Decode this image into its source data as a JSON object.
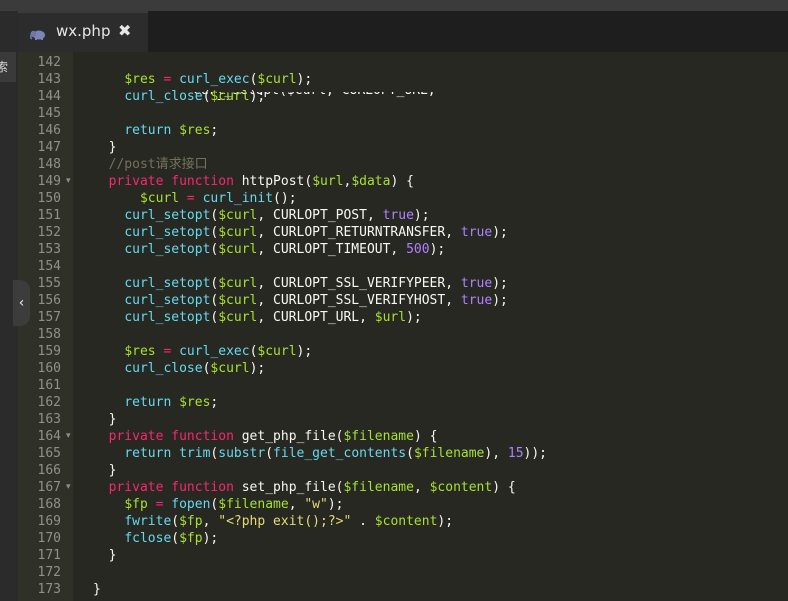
{
  "left_panel": {
    "tab_text": "索"
  },
  "tab": {
    "label": "wx.php",
    "close_glyph": "✖"
  },
  "colors": {
    "variable": "#a6e22e",
    "function": "#66d9ef",
    "keyword": "#f92672",
    "boolean": "#ae81ff",
    "string": "#e6db74",
    "comment": "#75715e",
    "text": "#f8f8f2"
  },
  "lines": [
    {
      "n": "142",
      "fold": "",
      "tokens": []
    },
    {
      "n": "143",
      "fold": "",
      "tokens": [
        [
          "txt",
          "    "
        ],
        [
          "var",
          "$res"
        ],
        [
          "op",
          " = "
        ],
        [
          "fn",
          "curl_exec"
        ],
        [
          "txt",
          "("
        ],
        [
          "var",
          "$curl"
        ],
        [
          "txt",
          ");"
        ]
      ]
    },
    {
      "n": "144",
      "fold": "",
      "tokens": [
        [
          "txt",
          "    "
        ],
        [
          "fn",
          "curl_close"
        ],
        [
          "txt",
          "("
        ],
        [
          "var",
          "$curl"
        ],
        [
          "txt",
          ");"
        ]
      ]
    },
    {
      "n": "145",
      "fold": "",
      "tokens": []
    },
    {
      "n": "146",
      "fold": "",
      "tokens": [
        [
          "txt",
          "    "
        ],
        [
          "fn",
          "return"
        ],
        [
          "txt",
          " "
        ],
        [
          "var",
          "$res"
        ],
        [
          "txt",
          ";"
        ]
      ]
    },
    {
      "n": "147",
      "fold": "",
      "tokens": [
        [
          "txt",
          "  }"
        ]
      ]
    },
    {
      "n": "148",
      "fold": "",
      "tokens": [
        [
          "txt",
          "  "
        ],
        [
          "cmt",
          "//post请求接口"
        ]
      ]
    },
    {
      "n": "149",
      "fold": "▾",
      "tokens": [
        [
          "txt",
          "  "
        ],
        [
          "kw",
          "private"
        ],
        [
          "txt",
          " "
        ],
        [
          "kw",
          "function"
        ],
        [
          "txt",
          " httpPost("
        ],
        [
          "var",
          "$url"
        ],
        [
          "txt",
          ","
        ],
        [
          "var",
          "$data"
        ],
        [
          "txt",
          ") {"
        ]
      ]
    },
    {
      "n": "150",
      "fold": "",
      "tokens": [
        [
          "txt",
          "      "
        ],
        [
          "var",
          "$curl"
        ],
        [
          "op",
          " = "
        ],
        [
          "fn",
          "curl_init"
        ],
        [
          "txt",
          "();"
        ]
      ]
    },
    {
      "n": "151",
      "fold": "",
      "tokens": [
        [
          "txt",
          "    "
        ],
        [
          "fn",
          "curl_setopt"
        ],
        [
          "txt",
          "("
        ],
        [
          "var",
          "$curl"
        ],
        [
          "txt",
          ", CURLOPT_POST, "
        ],
        [
          "bool",
          "true"
        ],
        [
          "txt",
          ");"
        ]
      ]
    },
    {
      "n": "152",
      "fold": "",
      "tokens": [
        [
          "txt",
          "    "
        ],
        [
          "fn",
          "curl_setopt"
        ],
        [
          "txt",
          "("
        ],
        [
          "var",
          "$curl"
        ],
        [
          "txt",
          ", CURLOPT_RETURNTRANSFER, "
        ],
        [
          "bool",
          "true"
        ],
        [
          "txt",
          ");"
        ]
      ]
    },
    {
      "n": "153",
      "fold": "",
      "tokens": [
        [
          "txt",
          "    "
        ],
        [
          "fn",
          "curl_setopt"
        ],
        [
          "txt",
          "("
        ],
        [
          "var",
          "$curl"
        ],
        [
          "txt",
          ", CURLOPT_TIMEOUT, "
        ],
        [
          "bool",
          "500"
        ],
        [
          "txt",
          ");"
        ]
      ]
    },
    {
      "n": "154",
      "fold": "",
      "tokens": []
    },
    {
      "n": "155",
      "fold": "",
      "tokens": [
        [
          "txt",
          "    "
        ],
        [
          "fn",
          "curl_setopt"
        ],
        [
          "txt",
          "("
        ],
        [
          "var",
          "$curl"
        ],
        [
          "txt",
          ", CURLOPT_SSL_VERIFYPEER, "
        ],
        [
          "bool",
          "true"
        ],
        [
          "txt",
          ");"
        ]
      ]
    },
    {
      "n": "156",
      "fold": "",
      "tokens": [
        [
          "txt",
          "    "
        ],
        [
          "fn",
          "curl_setopt"
        ],
        [
          "txt",
          "("
        ],
        [
          "var",
          "$curl"
        ],
        [
          "txt",
          ", CURLOPT_SSL_VERIFYHOST, "
        ],
        [
          "bool",
          "true"
        ],
        [
          "txt",
          ");"
        ]
      ]
    },
    {
      "n": "157",
      "fold": "",
      "tokens": [
        [
          "txt",
          "    "
        ],
        [
          "fn",
          "curl_setopt"
        ],
        [
          "txt",
          "("
        ],
        [
          "var",
          "$curl"
        ],
        [
          "txt",
          ", CURLOPT_URL, "
        ],
        [
          "var",
          "$url"
        ],
        [
          "txt",
          ");"
        ]
      ]
    },
    {
      "n": "158",
      "fold": "",
      "tokens": []
    },
    {
      "n": "159",
      "fold": "",
      "tokens": [
        [
          "txt",
          "    "
        ],
        [
          "var",
          "$res"
        ],
        [
          "op",
          " = "
        ],
        [
          "fn",
          "curl_exec"
        ],
        [
          "txt",
          "("
        ],
        [
          "var",
          "$curl"
        ],
        [
          "txt",
          ");"
        ]
      ]
    },
    {
      "n": "160",
      "fold": "",
      "tokens": [
        [
          "txt",
          "    "
        ],
        [
          "fn",
          "curl_close"
        ],
        [
          "txt",
          "("
        ],
        [
          "var",
          "$curl"
        ],
        [
          "txt",
          ");"
        ]
      ]
    },
    {
      "n": "161",
      "fold": "",
      "tokens": []
    },
    {
      "n": "162",
      "fold": "",
      "tokens": [
        [
          "txt",
          "    "
        ],
        [
          "fn",
          "return"
        ],
        [
          "txt",
          " "
        ],
        [
          "var",
          "$res"
        ],
        [
          "txt",
          ";"
        ]
      ]
    },
    {
      "n": "163",
      "fold": "",
      "tokens": [
        [
          "txt",
          "  }"
        ]
      ]
    },
    {
      "n": "164",
      "fold": "▾",
      "tokens": [
        [
          "txt",
          "  "
        ],
        [
          "kw",
          "private"
        ],
        [
          "txt",
          " "
        ],
        [
          "kw",
          "function"
        ],
        [
          "txt",
          " get_php_file("
        ],
        [
          "var",
          "$filename"
        ],
        [
          "txt",
          ") {"
        ]
      ]
    },
    {
      "n": "165",
      "fold": "",
      "tokens": [
        [
          "txt",
          "    "
        ],
        [
          "fn",
          "return"
        ],
        [
          "txt",
          " "
        ],
        [
          "fn",
          "trim"
        ],
        [
          "txt",
          "("
        ],
        [
          "fn",
          "substr"
        ],
        [
          "txt",
          "("
        ],
        [
          "fn",
          "file_get_contents"
        ],
        [
          "txt",
          "("
        ],
        [
          "var",
          "$filename"
        ],
        [
          "txt",
          "), "
        ],
        [
          "bool",
          "15"
        ],
        [
          "txt",
          "));"
        ]
      ]
    },
    {
      "n": "166",
      "fold": "",
      "tokens": [
        [
          "txt",
          "  }"
        ]
      ]
    },
    {
      "n": "167",
      "fold": "▾",
      "tokens": [
        [
          "txt",
          "  "
        ],
        [
          "kw",
          "private"
        ],
        [
          "txt",
          " "
        ],
        [
          "kw",
          "function"
        ],
        [
          "txt",
          " set_php_file("
        ],
        [
          "var",
          "$filename"
        ],
        [
          "txt",
          ", "
        ],
        [
          "var",
          "$content"
        ],
        [
          "txt",
          ") {"
        ]
      ]
    },
    {
      "n": "168",
      "fold": "",
      "tokens": [
        [
          "txt",
          "    "
        ],
        [
          "var",
          "$fp"
        ],
        [
          "op",
          " = "
        ],
        [
          "fn",
          "fopen"
        ],
        [
          "txt",
          "("
        ],
        [
          "var",
          "$filename"
        ],
        [
          "txt",
          ", "
        ],
        [
          "str",
          "\"w\""
        ],
        [
          "txt",
          ");"
        ]
      ]
    },
    {
      "n": "169",
      "fold": "",
      "tokens": [
        [
          "txt",
          "    "
        ],
        [
          "fn",
          "fwrite"
        ],
        [
          "txt",
          "("
        ],
        [
          "var",
          "$fp"
        ],
        [
          "txt",
          ", "
        ],
        [
          "str",
          "\"<?php exit();?>\""
        ],
        [
          "txt",
          " . "
        ],
        [
          "var",
          "$content"
        ],
        [
          "txt",
          ");"
        ]
      ]
    },
    {
      "n": "170",
      "fold": "",
      "tokens": [
        [
          "txt",
          "    "
        ],
        [
          "fn",
          "fclose"
        ],
        [
          "txt",
          "("
        ],
        [
          "var",
          "$fp"
        ],
        [
          "txt",
          ");"
        ]
      ]
    },
    {
      "n": "171",
      "fold": "",
      "tokens": [
        [
          "txt",
          "  }"
        ]
      ]
    },
    {
      "n": "172",
      "fold": "",
      "tokens": []
    },
    {
      "n": "173",
      "fold": "",
      "tokens": [
        [
          "txt",
          "}"
        ]
      ]
    }
  ]
}
